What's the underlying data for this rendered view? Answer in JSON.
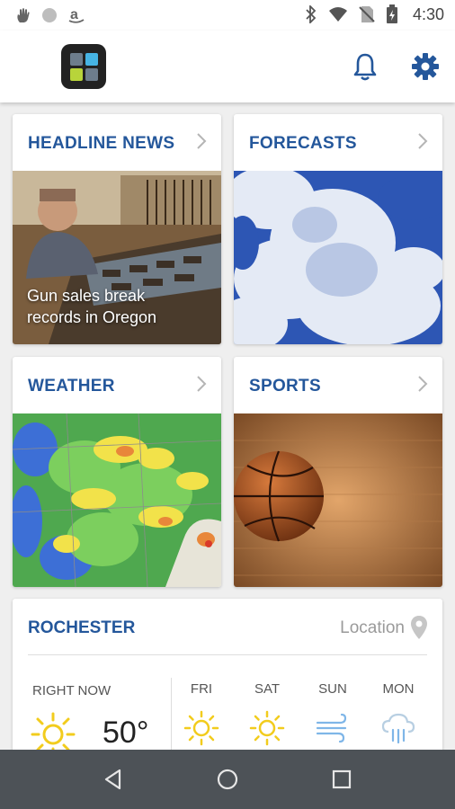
{
  "status_bar": {
    "time": "4:30",
    "icons": [
      "hand-notification-icon",
      "circle-notification-icon",
      "amazon-icon",
      "bluetooth-icon",
      "wifi-icon",
      "no-sim-icon",
      "battery-charging-icon"
    ]
  },
  "app_bar": {
    "logo_colors": [
      "#6d7d8c",
      "#46b4e4",
      "#b8d43a",
      "#6d7d8c"
    ],
    "icons": [
      "bell-icon",
      "gear-icon"
    ]
  },
  "cards": {
    "headline": {
      "title": "HEADLINE NEWS",
      "caption": "Gun sales break records in Oregon"
    },
    "forecasts": {
      "title": "FORECASTS"
    },
    "weather": {
      "title": "WEATHER"
    },
    "sports": {
      "title": "SPORTS"
    }
  },
  "weather_widget": {
    "city": "ROCHESTER",
    "location_label": "Location",
    "right_now_label": "RIGHT NOW",
    "current_temp": "50°",
    "forecast": [
      {
        "day": "FRI",
        "icon": "sun-icon"
      },
      {
        "day": "SAT",
        "icon": "sun-icon"
      },
      {
        "day": "SUN",
        "icon": "wind-icon"
      },
      {
        "day": "MON",
        "icon": "rain-cloud-icon"
      }
    ]
  },
  "colors": {
    "accent": "#24579b",
    "sun": "#f2cc1d",
    "navbar": "#4d5257"
  }
}
